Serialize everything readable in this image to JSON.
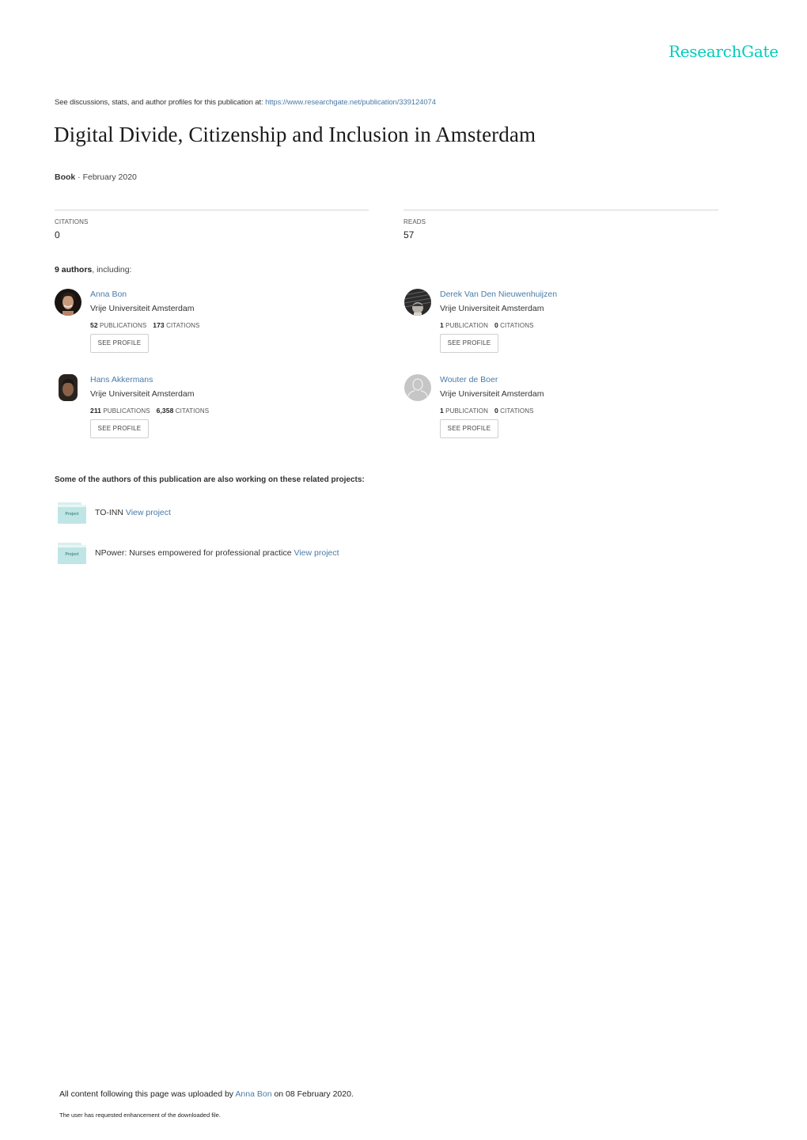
{
  "brand": {
    "name": "ResearchGate",
    "color": "#00ccbb"
  },
  "header": {
    "see_text": "See discussions, stats, and author profiles for this publication at: ",
    "see_link": "https://www.researchgate.net/publication/339124074"
  },
  "publication": {
    "title": "Digital Divide, Citizenship and Inclusion in Amsterdam",
    "type": "Book",
    "separator": " · ",
    "date": "February 2020"
  },
  "stats": {
    "citations_label": "CITATIONS",
    "citations_value": "0",
    "reads_label": "READS",
    "reads_value": "57"
  },
  "authors_section": {
    "count": "9 authors",
    "suffix": ", including:"
  },
  "authors": [
    {
      "name": "Anna Bon",
      "institution": "Vrije Universiteit Amsterdam",
      "publications": "52",
      "publications_label": "PUBLICATIONS",
      "citations": "173",
      "citations_label": "CITATIONS",
      "button": "SEE PROFILE",
      "avatar": "photo"
    },
    {
      "name": "Derek Van Den Nieuwenhuijzen",
      "institution": "Vrije Universiteit Amsterdam",
      "publications": "1",
      "publications_label": "PUBLICATION",
      "citations": "0",
      "citations_label": "CITATIONS",
      "button": "SEE PROFILE",
      "avatar": "photo"
    },
    {
      "name": "Hans Akkermans",
      "institution": "Vrije Universiteit Amsterdam",
      "publications": "211",
      "publications_label": "PUBLICATIONS",
      "citations": "6,358",
      "citations_label": "CITATIONS",
      "button": "SEE PROFILE",
      "avatar": "photo"
    },
    {
      "name": "Wouter de Boer",
      "institution": "Vrije Universiteit Amsterdam",
      "publications": "1",
      "publications_label": "PUBLICATION",
      "citations": "0",
      "citations_label": "CITATIONS",
      "button": "SEE PROFILE",
      "avatar": "placeholder"
    }
  ],
  "projects_section": {
    "heading": "Some of the authors of this publication are also working on these related projects:",
    "icon_label": "Project",
    "items": [
      {
        "name": "TO-INN",
        "link": "View project"
      },
      {
        "name": "NPower: Nurses empowered for professional practice",
        "link": "View project"
      }
    ]
  },
  "footer": {
    "uploaded_prefix": "All content following this page was uploaded by ",
    "uploader": "Anna Bon",
    "uploaded_suffix": " on 08 February 2020.",
    "note": "The user has requested enhancement of the downloaded file."
  },
  "colors": {
    "link": "#4a7ba8",
    "folder": "#bfe6e4"
  }
}
